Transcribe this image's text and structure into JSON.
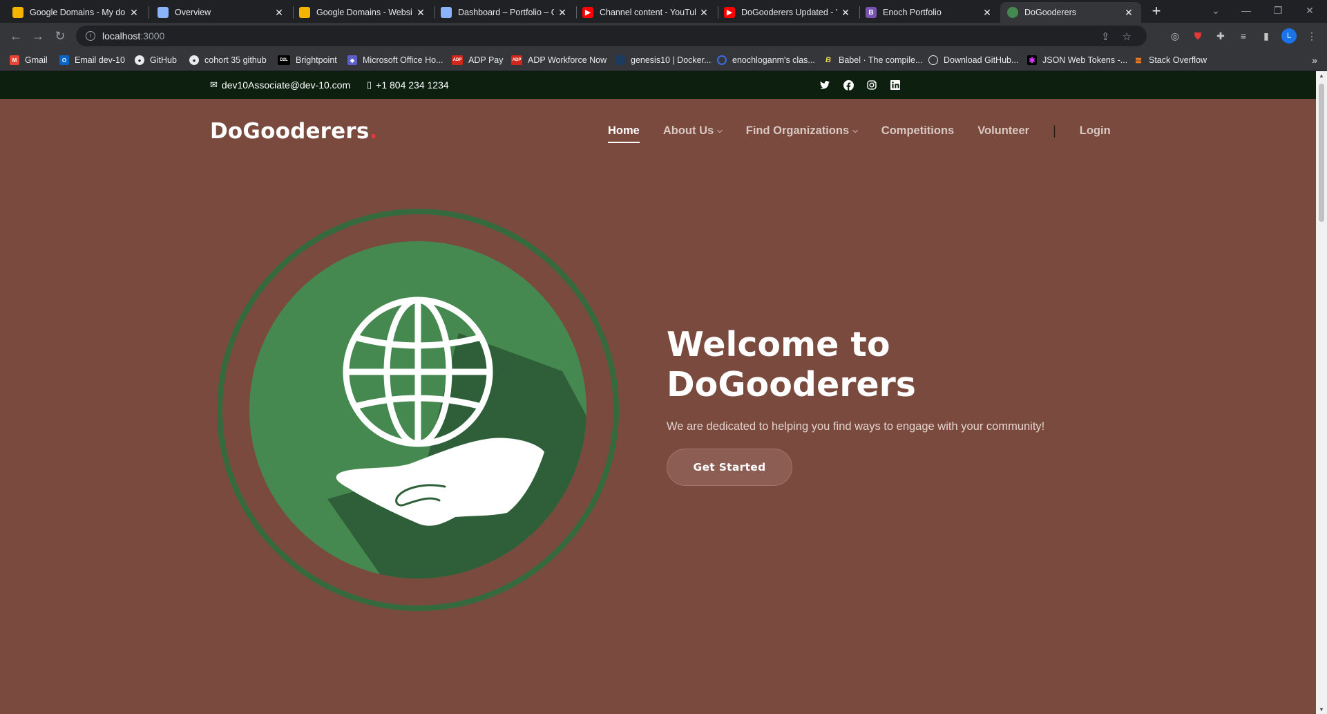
{
  "browser": {
    "tabs": [
      {
        "title": "Google Domains - My don",
        "icon": "google-domains-icon",
        "color": "#f4b400"
      },
      {
        "title": "Overview",
        "icon": "overview-icon",
        "color": "#8ab4f8"
      },
      {
        "title": "Google Domains - Website",
        "icon": "google-domains-icon",
        "color": "#f4b400"
      },
      {
        "title": "Dashboard – Portfolio – G",
        "icon": "dashboard-icon",
        "color": "#8ab4f8"
      },
      {
        "title": "Channel content - YouTub",
        "icon": "youtube-icon",
        "color": "#ff0000"
      },
      {
        "title": "DoGooderers Updated - Y",
        "icon": "youtube-icon",
        "color": "#ff0000"
      },
      {
        "title": "Enoch Portfolio",
        "icon": "bootstrap-icon",
        "color": "#7952b3"
      },
      {
        "title": "DoGooderers",
        "icon": "dogooderers-icon",
        "color": "#468950"
      }
    ],
    "close_glyph": "✕",
    "new_tab_glyph": "+",
    "address": {
      "host": "localhost",
      "port": ":3000"
    },
    "bookmarks": [
      {
        "label": "Gmail",
        "icon": "gmail-icon",
        "color": "#ea4335",
        "glyph": "M"
      },
      {
        "label": "Email dev-10",
        "icon": "outlook-icon",
        "color": "#0a64c8",
        "glyph": "O"
      },
      {
        "label": "GitHub",
        "icon": "github-icon",
        "color": "#e8eaed",
        "glyph": "●"
      },
      {
        "label": "cohort 35 github",
        "icon": "github-icon",
        "color": "#e8eaed",
        "glyph": "●"
      },
      {
        "label": "Brightpoint",
        "icon": "brightpoint-icon",
        "color": "#000000",
        "glyph": "D2L"
      },
      {
        "label": "Microsoft Office Ho...",
        "icon": "office-icon",
        "color": "#5b5fc7",
        "glyph": "◆"
      },
      {
        "label": "ADP Pay",
        "icon": "adp-icon",
        "color": "#d0271d",
        "glyph": "ADP"
      },
      {
        "label": "ADP Workforce Now",
        "icon": "adp-icon",
        "color": "#d0271d",
        "glyph": "ADP"
      },
      {
        "label": "genesis10 | Docker...",
        "icon": "docker-icon",
        "color": "#1d63ed",
        "glyph": "≡"
      },
      {
        "label": "enochloganm's clas...",
        "icon": "classroom-icon",
        "color": "#3d6ce6",
        "glyph": "Q"
      },
      {
        "label": "Babel · The compile...",
        "icon": "babel-icon",
        "color": "#f5da55",
        "glyph": "B"
      },
      {
        "label": "Download GitHub...",
        "icon": "github-desktop-icon",
        "color": "#e8eaed",
        "glyph": "◉"
      },
      {
        "label": "JSON Web Tokens -...",
        "icon": "jwt-icon",
        "color": "#d63aff",
        "glyph": "✱"
      },
      {
        "label": "Stack Overflow",
        "icon": "stackoverflow-icon",
        "color": "#f48024",
        "glyph": "≣"
      }
    ],
    "bookmarks_more": "»"
  },
  "site": {
    "topbar": {
      "email": "dev10Associate@dev-10.com",
      "phone": "+1 804 234 1234",
      "social": [
        "twitter-icon",
        "facebook-icon",
        "instagram-icon",
        "linkedin-icon"
      ]
    },
    "logo": {
      "text": "DoGooderers",
      "dot": "."
    },
    "nav": [
      {
        "label": "Home",
        "active": true,
        "dropdown": false
      },
      {
        "label": "About Us",
        "active": false,
        "dropdown": true
      },
      {
        "label": "Find Organizations",
        "active": false,
        "dropdown": true
      },
      {
        "label": "Competitions",
        "active": false,
        "dropdown": false
      },
      {
        "label": "Volunteer",
        "active": false,
        "dropdown": false
      }
    ],
    "nav_divider": "|",
    "login_label": "Login",
    "hero": {
      "title": "Welcome to DoGooderers",
      "subtitle": "We are dedicated to helping you find ways to engage with your community!",
      "cta_label": "Get Started"
    },
    "colors": {
      "background": "#7b4a3e",
      "topbar": "#0d200f",
      "ring": "#346a3e",
      "disc": "#468950",
      "shadow": "#2f5f38",
      "logo_dot": "#e03a3a"
    }
  }
}
